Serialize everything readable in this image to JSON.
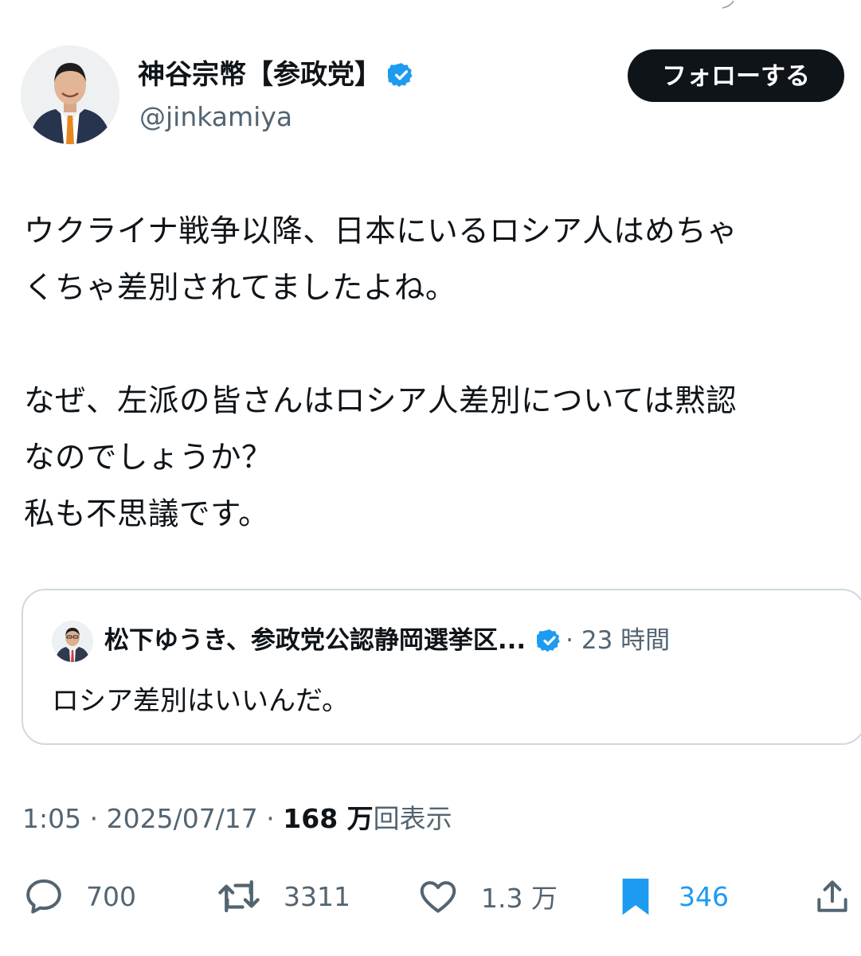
{
  "author": {
    "display_name": "神谷宗幣【参政党】",
    "handle": "@jinkamiya",
    "verified_icon": "verified-badge-icon",
    "verified_color": "#1d9bf0"
  },
  "follow_label": "フォローする",
  "tweet": {
    "lines": [
      "ウクライナ戦争以降、日本にいるロシア人はめちゃ",
      "くちゃ差別されてましたよね。",
      "",
      "なぜ、左派の皆さんはロシア人差別については黙認",
      "なのでしょうか？",
      "私も不思議です。"
    ]
  },
  "quote": {
    "name": "松下ゆうき、参政党公認静岡選挙区...",
    "time": "· 23 時間",
    "text": "ロシア差別はいいんだ。"
  },
  "meta": {
    "time": "1:05",
    "sep1": " · ",
    "date": "2025/07/17",
    "sep2": " · ",
    "views_num": "168 万",
    "views_label": "回表示"
  },
  "actions": {
    "reply_count": "700",
    "retweet_count": "3311",
    "like_count": "1.3 万",
    "bookmark_count": "346",
    "icons": [
      "reply-icon",
      "retweet-icon",
      "like-icon",
      "bookmark-icon",
      "share-icon"
    ],
    "bookmark_color": "#1d9bf0"
  },
  "colors": {
    "text": "#0f1419",
    "secondary": "#536471",
    "border": "#cfd9de",
    "button_bg": "#0f1419"
  }
}
